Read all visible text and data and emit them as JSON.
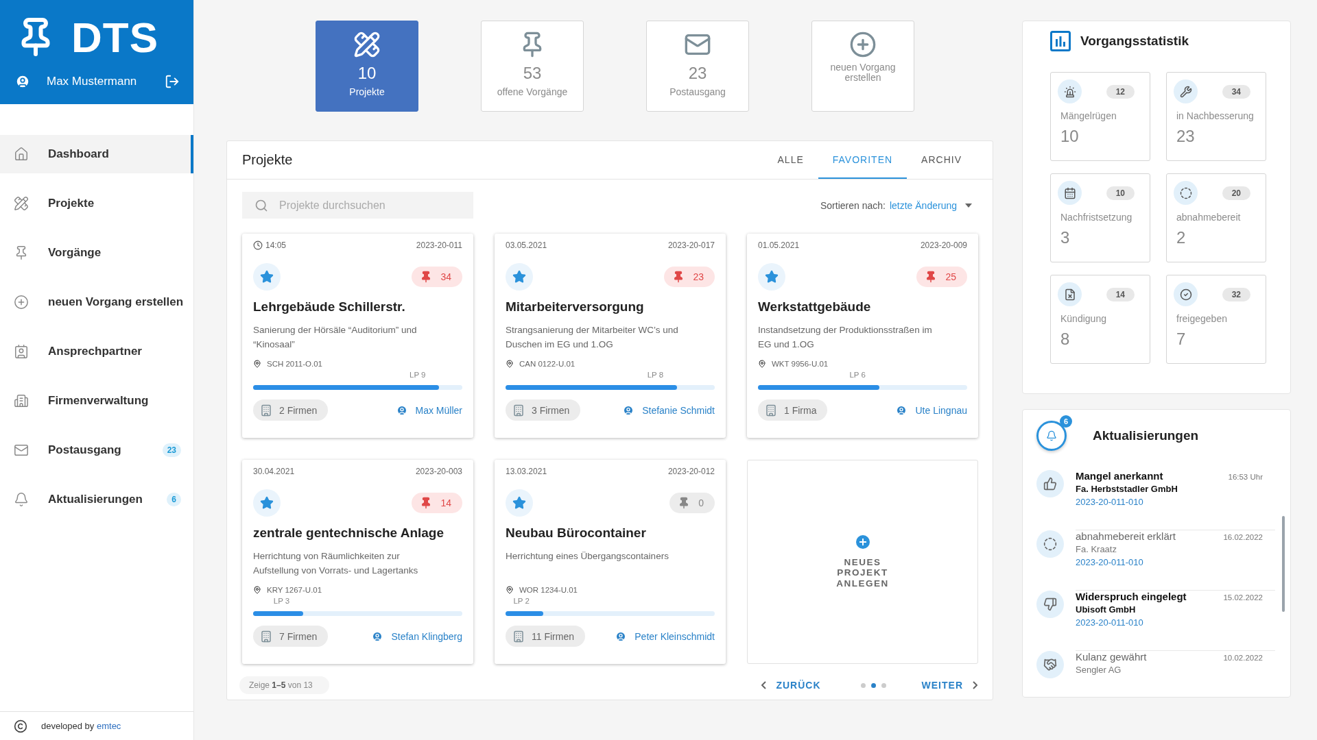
{
  "app": {
    "logo_text": "DTS",
    "user": "Max Mustermann"
  },
  "nav": [
    {
      "label": "Dashboard",
      "selected": true
    },
    {
      "label": "Projekte",
      "selected": false
    },
    {
      "label": "Vorgänge",
      "selected": false
    },
    {
      "label": "neuen Vorgang erstellen",
      "selected": false
    },
    {
      "label": "Ansprechpartner",
      "selected": false
    },
    {
      "label": "Firmenverwaltung",
      "selected": false
    },
    {
      "label": "Postausgang",
      "selected": false,
      "badge": "23"
    },
    {
      "label": "Aktualisierungen",
      "selected": false,
      "badge": "6"
    }
  ],
  "footer": {
    "prefix": "developed by",
    "link": "emtec"
  },
  "tiles": [
    {
      "count": "10",
      "label": "Projekte",
      "selected": true
    },
    {
      "count": "53",
      "label": "offene Vorgänge",
      "selected": false
    },
    {
      "count": "23",
      "label": "Postausgang",
      "selected": false
    },
    {
      "label": "neuen Vorgang erstellen",
      "selected": false
    }
  ],
  "projects": {
    "title": "Projekte",
    "tabs": [
      {
        "label": "ALLE",
        "selected": false
      },
      {
        "label": "FAVORITEN",
        "selected": true
      },
      {
        "label": "ARCHIV",
        "selected": false
      }
    ],
    "search": {
      "placeholder": "Projekte durchsuchen"
    },
    "sort": {
      "label": "Sortieren nach:",
      "value": "letzte Änderung"
    },
    "cards": [
      {
        "date": "14:05",
        "recent": true,
        "number": "2023-20-011",
        "favorite": true,
        "open_count": "34",
        "alert": true,
        "title": "Lehrgebäude Schillerstr.",
        "description": "Sanierung der Hörsäle “Auditorium” und “Kinosaal”",
        "location": "SCH 2011-O.01",
        "phase": "LP 9",
        "level": 0.89,
        "firms": "2 Firmen",
        "contact": "Max Müller"
      },
      {
        "date": "03.05.2021",
        "recent": false,
        "number": "2023-20-017",
        "favorite": true,
        "open_count": "23",
        "alert": true,
        "title": "Mitarbeiterversorgung",
        "description": "Strangsanierung der Mitarbeiter WC’s und Duschen im EG und 1.OG",
        "location": "CAN 0122-U.01",
        "phase": "LP 8",
        "level": 0.82,
        "firms": "3 Firmen",
        "contact": "Stefanie Schmidt"
      },
      {
        "date": "01.05.2021",
        "recent": false,
        "number": "2023-20-009",
        "favorite": true,
        "open_count": "25",
        "alert": true,
        "title": "Werkstattgebäude",
        "description": "Instandsetzung der Produktionsstraßen im EG und 1.OG",
        "location": "WKT 9956-U.01",
        "phase": "LP 6",
        "level": 0.58,
        "firms": "1 Firma",
        "contact": "Ute Lingnau"
      },
      {
        "date": "30.04.2021",
        "recent": false,
        "number": "2023-20-003",
        "favorite": true,
        "open_count": "14",
        "alert": true,
        "title": "zentrale gentechnische Anlage",
        "description": "Herrichtung von Räumlichkeiten zur Aufstellung von Vorrats- und Lagertanks",
        "location": "KRY 1267-U.01",
        "phase": "LP 3",
        "level": 0.24,
        "firms": "7 Firmen",
        "contact": "Stefan Klingberg"
      },
      {
        "date": "13.03.2021",
        "recent": false,
        "number": "2023-20-012",
        "favorite": true,
        "open_count": "0",
        "alert": false,
        "title": "Neubau Bürocontainer",
        "description": "Herrichtung eines Übergangscontainers",
        "location": "WOR 1234-U.01",
        "phase": "LP 2",
        "level": 0.18,
        "firms": "11 Firmen",
        "contact": "Peter Kleinschmidt"
      }
    ],
    "new_card": {
      "label": "NEUES PROJEKT ANLEGEN"
    },
    "pagination": {
      "summary": "Zeige **1–5** von 13",
      "back": "ZURÜCK",
      "next": "WEITER",
      "pages": [
        {
          "selected": false
        },
        {
          "selected": true
        },
        {
          "selected": false
        }
      ]
    }
  },
  "stats": {
    "title": "Vorgangsstatistik",
    "items": [
      {
        "badge": "12",
        "label": "Mängelrügen",
        "value": "10"
      },
      {
        "badge": "34",
        "label": "in Nachbesserung",
        "value": "23"
      },
      {
        "badge": "10",
        "label": "Nachfristsetzung",
        "value": "3"
      },
      {
        "badge": "20",
        "label": "abnahmebereit",
        "value": "2"
      },
      {
        "badge": "14",
        "label": "Kündigung",
        "value": "8"
      },
      {
        "badge": "32",
        "label": "freigegeben",
        "value": "7"
      }
    ]
  },
  "updates": {
    "title": "Aktualisierungen",
    "badge": "6",
    "items": [
      {
        "title": "Mangel anerkannt",
        "company": "Fa. Herbststadler GmbH",
        "reference": "2023-20-011-010",
        "time": "16:53 Uhr",
        "unread": true
      },
      {
        "title": "abnahmebereit erklärt",
        "company": "Fa. Kraatz",
        "reference": "2023-20-011-010",
        "time": "16.02.2022",
        "unread": false
      },
      {
        "title": "Widerspruch eingelegt",
        "company": "Ubisoft GmbH",
        "reference": "2023-20-011-010",
        "time": "15.02.2022",
        "unread": true
      },
      {
        "title": "Kulanz gewährt",
        "company": "Sengler AG",
        "time": "10.02.2022",
        "unread": false
      }
    ]
  }
}
